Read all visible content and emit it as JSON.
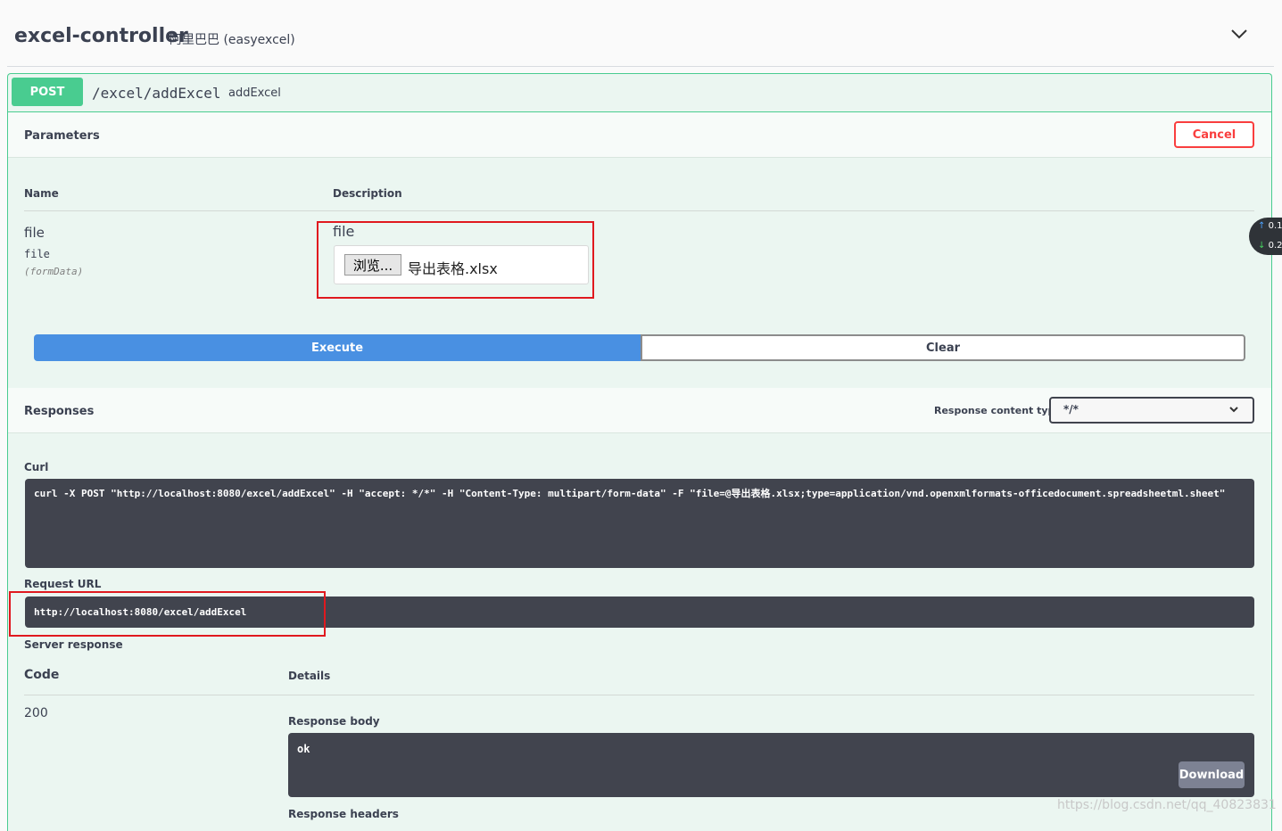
{
  "tag": {
    "title": "excel-controller",
    "description": "阿里巴巴 (easyexcel)"
  },
  "operation": {
    "method": "POST",
    "path": "/excel/addExcel",
    "summary": "addExcel"
  },
  "parameters": {
    "title": "Parameters",
    "cancel_label": "Cancel",
    "col_name": "Name",
    "col_description": "Description",
    "items": [
      {
        "name": "file",
        "type": "file",
        "in": "(formData)",
        "description": "file",
        "browse_label": "浏览...",
        "file_name": "导出表格.xlsx"
      }
    ],
    "execute_label": "Execute",
    "clear_label": "Clear"
  },
  "responses": {
    "title": "Responses",
    "content_type_label": "Response content type",
    "content_type_value": "*/*",
    "curl_label": "Curl",
    "curl_command": "curl -X POST \"http://localhost:8080/excel/addExcel\" -H \"accept: */*\" -H \"Content-Type: multipart/form-data\" -F \"file=@导出表格.xlsx;type=application/vnd.openxmlformats-officedocument.spreadsheetml.sheet\"",
    "request_url_label": "Request URL",
    "request_url": "http://localhost:8080/excel/addExcel",
    "server_response_label": "Server response",
    "code_header": "Code",
    "details_header": "Details",
    "code": "200",
    "response_body_label": "Response body",
    "response_body": "ok",
    "download_label": "Download",
    "response_headers_label": "Response headers"
  },
  "speed_widget": {
    "up": "0.1",
    "down": "0.2"
  },
  "watermark": "https://blog.csdn.net/qq_40823831",
  "colors": {
    "post": "#49cc90",
    "execute": "#4990e2",
    "cancel": "#f93e3e",
    "code_bg": "#41444e",
    "highlight": "#e0191f"
  }
}
